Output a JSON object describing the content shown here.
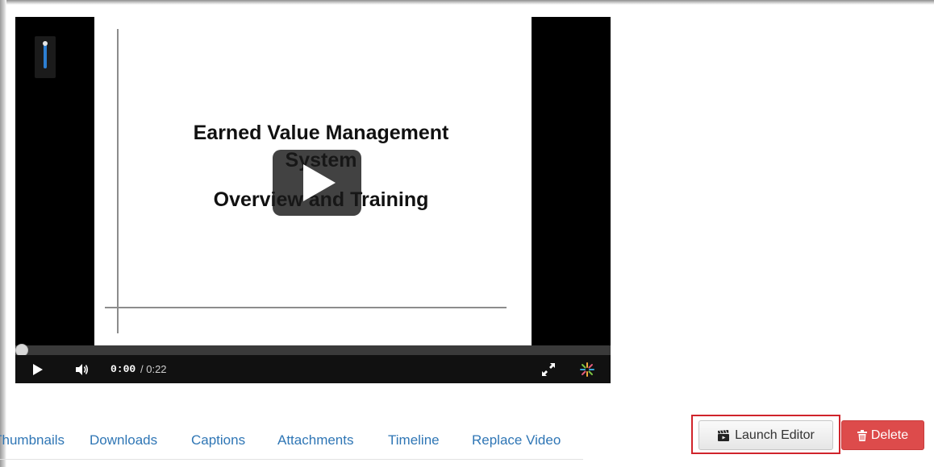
{
  "player": {
    "slide": {
      "title_line1": "Earned Value Management",
      "title_line2": "System",
      "title_line3": "Overview and Training"
    },
    "time_current": "0:00",
    "time_total": "/ 0:22",
    "progress_fraction": 0.0,
    "icons": {
      "play": "play-icon",
      "volume": "volume-icon",
      "fullscreen": "fullscreen-icon",
      "brand": "kaltura-logo-icon"
    }
  },
  "tabs": [
    {
      "label": "Thumbnails"
    },
    {
      "label": "Downloads"
    },
    {
      "label": "Captions"
    },
    {
      "label": "Attachments"
    },
    {
      "label": "Timeline"
    },
    {
      "label": "Replace Video"
    }
  ],
  "actions": {
    "launch_editor": "Launch Editor",
    "delete": "Delete"
  },
  "colors": {
    "link": "#2f76b5",
    "delete": "#dd4b4b",
    "highlight": "#d0242b"
  }
}
